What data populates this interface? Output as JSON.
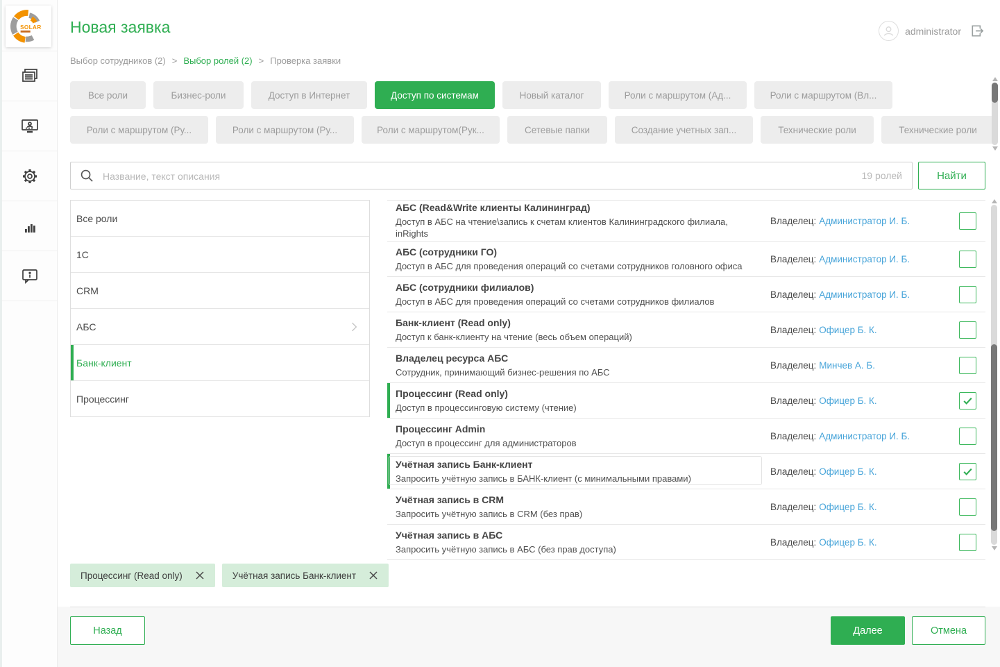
{
  "app": {
    "logo_text": "SOLAR",
    "user_name": "administrator"
  },
  "header": {
    "title": "Новая заявка"
  },
  "breadcrumb": {
    "separator": ">",
    "items": [
      "Выбор сотрудников (2)",
      "Выбор ролей (2)",
      "Проверка заявки"
    ],
    "active_index": 1
  },
  "tabs": {
    "active": "Доступ по системам",
    "row1": [
      "Все роли",
      "Бизнес-роли",
      "Доступ в Интернет",
      "Доступ по системам",
      "Новый каталог",
      "Роли с маршрутом (Ад...",
      "Роли с маршрутом (Вл..."
    ],
    "row2": [
      "Роли с маршрутом (Ру...",
      "Роли с маршрутом (Ру...",
      "Роли с маршрутом(Рук...",
      "Сетевые папки",
      "Создание учетных зап...",
      "Технические роли",
      "Технические роли"
    ]
  },
  "search": {
    "placeholder": "Название, текст описания",
    "count": "19 ролей",
    "button": "Найти"
  },
  "categories": {
    "items": [
      {
        "label": "Все роли",
        "selected": false
      },
      {
        "label": "1С",
        "selected": false
      },
      {
        "label": "CRM",
        "selected": false
      },
      {
        "label": "АБС",
        "selected": false,
        "has_children": true
      },
      {
        "label": "Банк-клиент",
        "selected": true
      },
      {
        "label": "Процессинг",
        "selected": false
      }
    ]
  },
  "roles": {
    "owner_label": "Владелец:",
    "items": [
      {
        "title": "АБС (Read&Write клиенты Калининград)",
        "desc": "Доступ в АБС на чтение\\запись к счетам клиентов Калининградского филиала,",
        "desc2": "inRights",
        "owner": "Администратор И. Б.",
        "checked": false
      },
      {
        "title": "АБС (сотрудники ГО)",
        "desc": "Доступ в АБС для проведения операций со счетами сотрудников головного офиса",
        "owner": "Администратор И. Б.",
        "checked": false
      },
      {
        "title": "АБС (сотрудники филиалов)",
        "desc": "Доступ в АБС для проведения операций со счетами сотрудников филиалов",
        "owner": "Администратор И. Б.",
        "checked": false
      },
      {
        "title": "Банк-клиент (Read only)",
        "desc": "Доступ к банк-клиенту на чтение (весь объем операций)",
        "owner": "Офицер Б. К.",
        "checked": false
      },
      {
        "title": "Владелец ресурса АБС",
        "desc": "Сотрудник, принимающий бизнес-решения по АБС",
        "owner": "Минчев А. Б.",
        "checked": false
      },
      {
        "title": "Процессинг (Read only)",
        "desc": "Доступ в процессинговую систему (чтение)",
        "owner": "Офицер Б. К.",
        "checked": true
      },
      {
        "title": "Процессинг Admin",
        "desc": "Доступ в процессинг для администраторов",
        "owner": "Администратор И. Б.",
        "checked": false
      },
      {
        "title": "Учётная запись Банк-клиент",
        "desc": "Запросить учётную запись в БАНК-клиент (с минимальными правами)",
        "owner": "Офицер Б. К.",
        "checked": true
      },
      {
        "title": "Учётная запись в CRM",
        "desc": "Запросить учётную запись в CRM (без прав)",
        "owner": "Офицер Б. К.",
        "checked": false
      },
      {
        "title": "Учётная запись в АБС",
        "desc": "Запросить учётную запись в АБС (без прав доступа)",
        "owner": "Офицер Б. К.",
        "checked": false
      }
    ]
  },
  "chips": {
    "items": [
      "Процессинг (Read only)",
      "Учётная запись Банк-клиент"
    ]
  },
  "footer": {
    "back": "Назад",
    "next": "Далее",
    "cancel": "Отмена"
  },
  "colors": {
    "accent_green": "#2fae52",
    "link_blue": "#47a4d9",
    "chip_background": "#d5edda",
    "tab_background": "#ededed",
    "footer_background": "#f7f7f7"
  }
}
